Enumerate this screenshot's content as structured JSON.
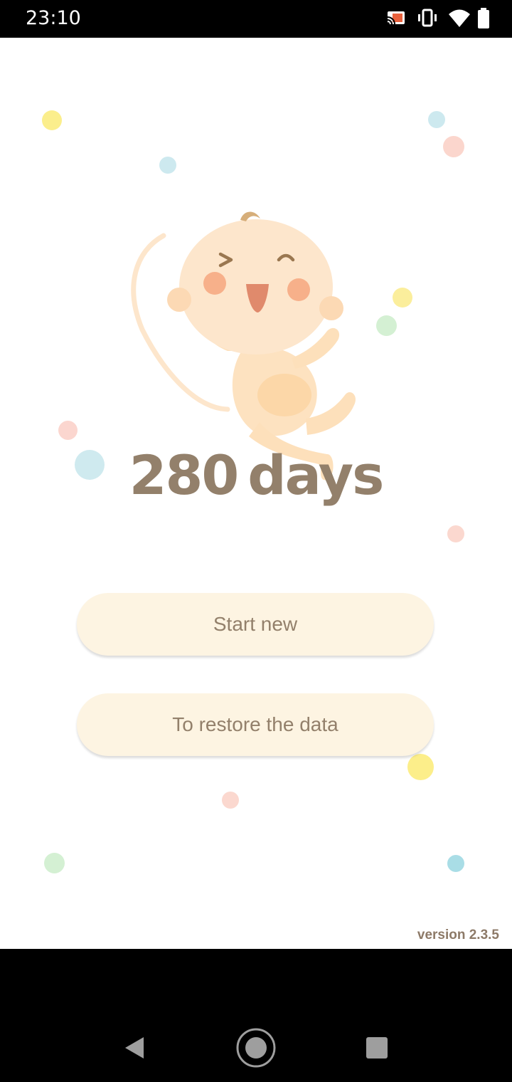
{
  "status_bar": {
    "time": "23:10",
    "icons": [
      "cast-icon",
      "vibrate-icon",
      "wifi-icon",
      "battery-icon"
    ]
  },
  "app": {
    "logo": {
      "number": "280",
      "word": "days"
    },
    "buttons": {
      "start_new": "Start new",
      "restore": "To restore the data"
    },
    "version": "version 2.3.5"
  },
  "nav_bar": {
    "icons": [
      "back-icon",
      "home-icon",
      "recents-icon"
    ]
  },
  "colors": {
    "accent_text": "#93806b",
    "button_bg": "#fdf4e2",
    "background": "#ffffff"
  }
}
